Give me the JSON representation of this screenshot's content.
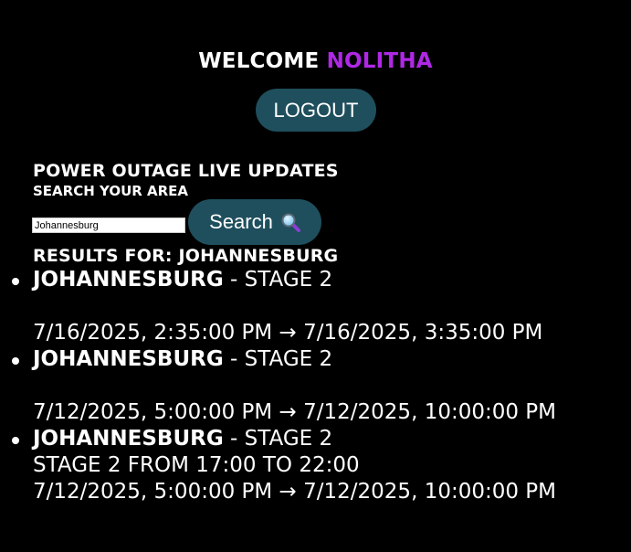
{
  "header": {
    "welcome_label": "WELCOME",
    "username": "NOLITHA",
    "logout_label": "LOGOUT"
  },
  "search": {
    "section_title": "POWER OUTAGE LIVE UPDATES",
    "section_subtitle": "SEARCH YOUR AREA",
    "input_value": "Johannesburg",
    "button_label": "Search",
    "button_icon": "magnifying-glass-icon"
  },
  "results": {
    "title": "RESULTS FOR: JOHANNESBURG",
    "items": [
      {
        "area": "JOHANNESBURG",
        "separator": " - ",
        "stage": "STAGE 2",
        "description": "",
        "time_range": "7/16/2025, 2:35:00 PM → 7/16/2025, 3:35:00 PM"
      },
      {
        "area": "JOHANNESBURG",
        "separator": " - ",
        "stage": "STAGE 2",
        "description": "",
        "time_range": "7/12/2025, 5:00:00 PM → 7/12/2025, 10:00:00 PM"
      },
      {
        "area": "JOHANNESBURG",
        "separator": " - ",
        "stage": "STAGE 2",
        "description": "STAGE 2 FROM 17:00 TO 22:00",
        "time_range": "7/12/2025, 5:00:00 PM → 7/12/2025, 10:00:00 PM"
      }
    ]
  },
  "colors": {
    "background": "#000000",
    "username_accent": "#b028e6",
    "button_background": "#1f4f5d",
    "text": "#ffffff"
  }
}
